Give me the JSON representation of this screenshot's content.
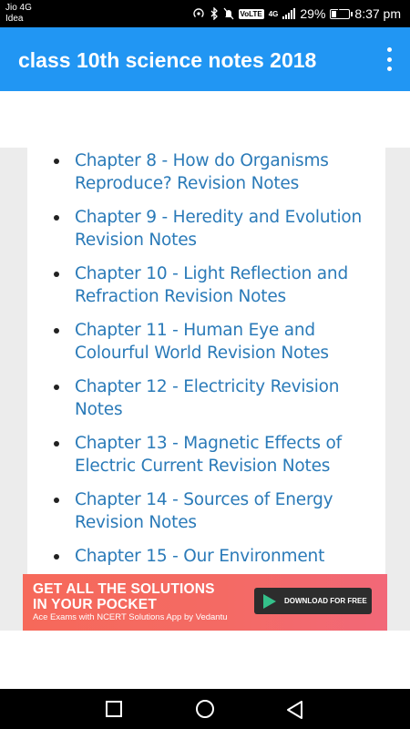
{
  "status_bar": {
    "carrier_line1": "Jio 4G",
    "carrier_line2": "Idea",
    "volte": "VoLTE",
    "network": "4G",
    "battery": "29%",
    "battery_level": 0.29,
    "time": "8:37 pm",
    "icons": [
      "hotspot-icon",
      "bluetooth-icon",
      "mute-icon",
      "signal-icon",
      "battery-charging-icon"
    ]
  },
  "app_bar": {
    "title": "class 10th science notes 2018",
    "menu_icon": "more-vertical-icon"
  },
  "notes": [
    {
      "label": "Chapter 8 - How do Organisms Reproduce? Revision Notes"
    },
    {
      "label": "Chapter 9 - Heredity and Evolution Revision Notes"
    },
    {
      "label": "Chapter 10 - Light Reflection and Refraction Revision Notes"
    },
    {
      "label": "Chapter 11 - Human Eye and Colourful World Revision Notes"
    },
    {
      "label": "Chapter 12 - Electricity Revision Notes"
    },
    {
      "label": "Chapter 13 - Magnetic Effects of Electric Current Revision Notes"
    },
    {
      "label": "Chapter 14 - Sources of Energy Revision Notes"
    },
    {
      "label": "Chapter 15 - Our Environment"
    }
  ],
  "ad_banner": {
    "headline_line1": "GET ALL THE SOLUTIONS",
    "headline_line2": "IN YOUR POCKET",
    "subtext": "Ace Exams with NCERT Solutions App by Vedantu",
    "button_label": "DOWNLOAD FOR FREE",
    "button_icon": "google-play-icon"
  },
  "nav_bar": {
    "icons": [
      "recent-apps-icon",
      "home-icon",
      "back-icon"
    ]
  },
  "colors": {
    "app_bar": "#2196f3",
    "link": "#2a7ab8",
    "ad_background": "#f46a64"
  }
}
